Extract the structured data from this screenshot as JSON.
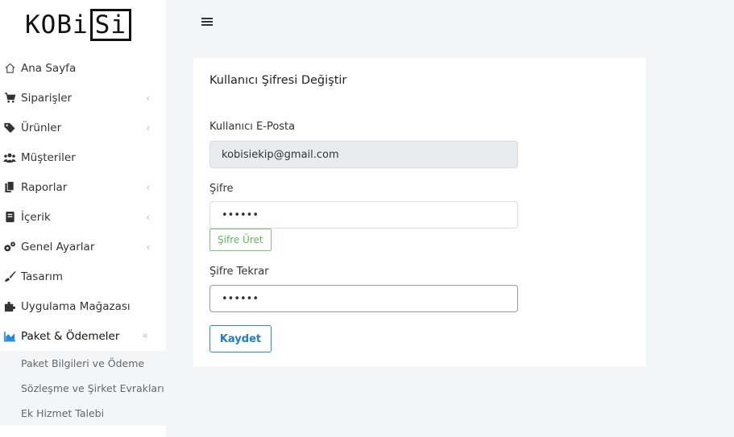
{
  "logo": {
    "text_plain": "KOBi",
    "text_boxed": "Si"
  },
  "sidebar": {
    "items": [
      {
        "label": "Ana Sayfa",
        "icon": "home-icon",
        "chevron": ""
      },
      {
        "label": "Siparişler",
        "icon": "cart-icon",
        "chevron": "‹"
      },
      {
        "label": "Ürünler",
        "icon": "tag-icon",
        "chevron": "‹"
      },
      {
        "label": "Müşteriler",
        "icon": "users-icon",
        "chevron": ""
      },
      {
        "label": "Raporlar",
        "icon": "copy-icon",
        "chevron": "‹"
      },
      {
        "label": "İçerik",
        "icon": "book-icon",
        "chevron": "‹"
      },
      {
        "label": "Genel Ayarlar",
        "icon": "cogs-icon",
        "chevron": "‹"
      },
      {
        "label": "Tasarım",
        "icon": "brush-icon",
        "chevron": ""
      },
      {
        "label": "Uygulama Mağazası",
        "icon": "puzzle-icon",
        "chevron": ""
      },
      {
        "label": "Paket & Ödemeler",
        "icon": "chart-area-icon",
        "chevron": "»",
        "active": true
      }
    ],
    "subitems": [
      {
        "label": "Paket Bilgileri ve Ödeme"
      },
      {
        "label": "Sözleşme ve Şirket Evrakları"
      },
      {
        "label": "Ek Hizmet Talebi"
      }
    ]
  },
  "header": {
    "menu_icon": "hamburger-icon"
  },
  "form": {
    "title": "Kullanıcı Şifresi Değiştir",
    "email_label": "Kullanıcı E-Posta",
    "email_value": "kobisiekip@gmail.com",
    "password_label": "Şifre",
    "password_value": "••••••",
    "generate_label": "Şifre Üret",
    "password_repeat_label": "Şifre Tekrar",
    "password_repeat_value": "••••••",
    "save_label": "Kaydet"
  },
  "colors": {
    "accent": "#1f7dc7",
    "success": "#5cb85c",
    "active_icon": "#1e88e5"
  }
}
